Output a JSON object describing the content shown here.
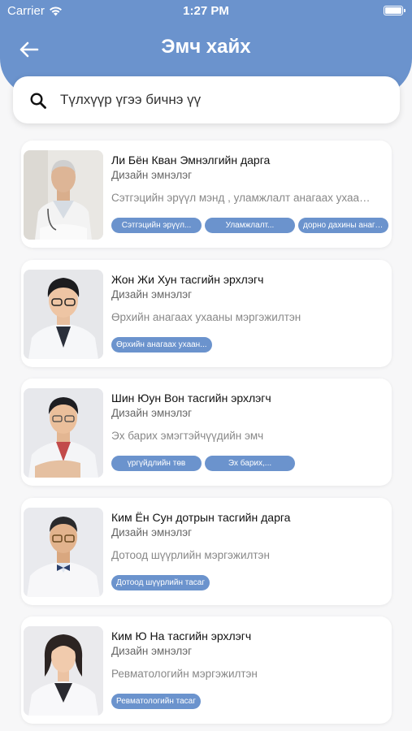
{
  "status_bar": {
    "carrier": "Carrier",
    "time": "1:27 PM"
  },
  "header": {
    "title": "Эмч хайх",
    "back_icon": "arrow-left-icon"
  },
  "search": {
    "placeholder": "Түлхүүр үгээ бичнэ үү",
    "icon": "search-icon"
  },
  "colors": {
    "accent": "#6b93cd",
    "background": "#f7f7f8"
  },
  "doctors": [
    {
      "name": "Ли Бён Кван Эмнэлгийн дарга",
      "hospital": "Дизайн эмнэлэг",
      "specialty": "Сэтгэцийн эрүүл мэнд , уламжлалт анагаах ухааны ...",
      "tags": [
        "Сэтгэцийн эрүүл...",
        "Уламжлалт...",
        "дорно дахины анагаа..."
      ]
    },
    {
      "name": "Жон Жи Хун тасгийн эрхлэгч",
      "hospital": "Дизайн эмнэлэг",
      "specialty": "Өрхийн анагаах ухааны мэргэжилтэн",
      "tags": [
        "Өрхийн анагаах ухаан..."
      ]
    },
    {
      "name": "Шин Юун Вон тасгийн эрхлэгч",
      "hospital": "Дизайн эмнэлэг",
      "specialty": "Эх барих эмэгтэйчүүдийн эмч",
      "tags": [
        "үргүйдлийн төв",
        "Эх барих,..."
      ]
    },
    {
      "name": "Ким Ён Сун дотрын тасгийн дарга",
      "hospital": "Дизайн эмнэлэг",
      "specialty": "Дотоод шүүрлийн мэргэжилтэн",
      "tags": [
        "Дотоод шүүрлийн тасаг"
      ]
    },
    {
      "name": "Ким Ю На тасгийн эрхлэгч",
      "hospital": "Дизайн эмнэлэг",
      "specialty": "Ревматологийн мэргэжилтэн",
      "tags": [
        "Ревматологийн тасаг"
      ]
    }
  ]
}
